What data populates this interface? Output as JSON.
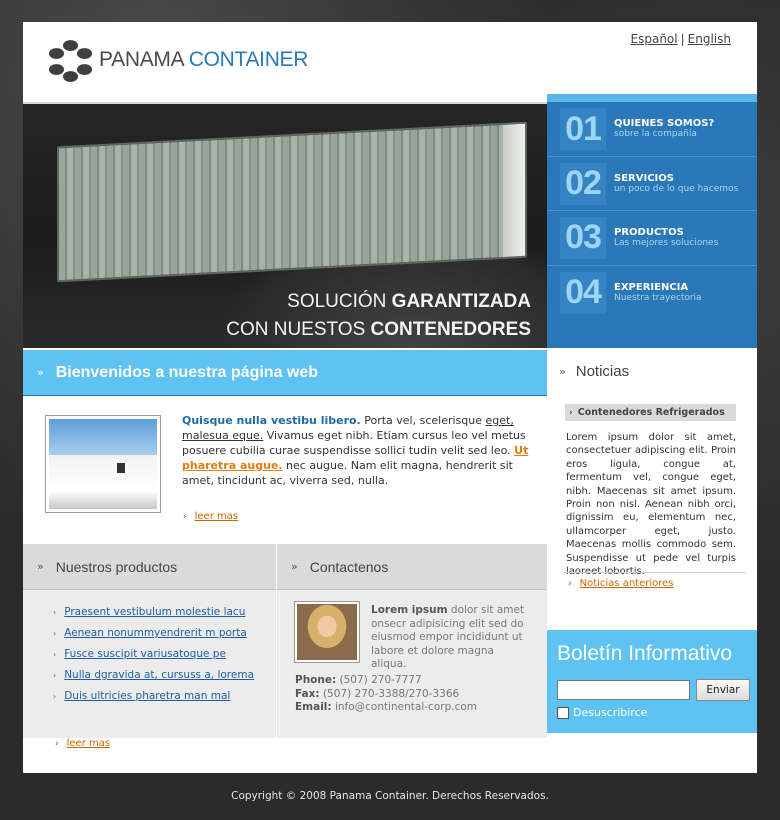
{
  "header": {
    "logo_text_part1": "PANAMA",
    "logo_text_part2": "CONTAINER",
    "lang_es": "Español",
    "lang_sep": "|",
    "lang_en": "English"
  },
  "hero": {
    "line1_normal": "SOLUCIÓN",
    "line1_bold": "GARANTIZADA",
    "line2_normal": "CON NUESTOS",
    "line2_bold": "CONTENEDORES"
  },
  "nav": {
    "items": [
      {
        "num": "01",
        "title": "QUIENES SOMOS?",
        "sub": "sobre la compañía"
      },
      {
        "num": "02",
        "title": "SERVICIOS",
        "sub": "un poco de lo que hacemos"
      },
      {
        "num": "03",
        "title": "PRODUCTOS",
        "sub": "Las mejores soluciones"
      },
      {
        "num": "04",
        "title": "EXPERIENCIA",
        "sub": "Nuestra trayectoria"
      }
    ]
  },
  "welcome": {
    "title": "Bienvenidos a nuestra página web",
    "lead": "Quisque nulla vestibu libero.",
    "text1": " Porta vel, scelerisque ",
    "link1": "eget, malesua eque.",
    "text2": " Vivamus eget nibh. Etiam cursus leo vel metus posuere cubilia curae suspendisse sollici tudin velit sed leo. ",
    "link2": "Ut pharetra augue.",
    "text3": " nec augue. Nam elit magna, hendrerit sit amet, tincidunt ac, viverra sed, nulla.",
    "more": "leer mas"
  },
  "products": {
    "title": "Nuestros productos",
    "items": [
      "Praesent vestibulum molestie lacu",
      "Aenean nonummyendrerit m porta",
      "Fusce suscipit variusatoque pe",
      "Nulla dgravida at, cursuss a, lorema",
      "Duis ultricies pharetra man mal"
    ],
    "more": "leer mas"
  },
  "contact": {
    "title": "Contactenos",
    "lead": "Lorem ipsum",
    "text": " dolor sit amet onsecr adipisicing elit sed do eiusmod empor incididunt ut labore et dolore magna aliqua.",
    "phone_label": "Phone:",
    "phone": " (507) 270-7777",
    "fax_label": "Fax:",
    "fax": " (507) 270-3388/270-3366",
    "email_label": "Email:",
    "email": " info@continental-corp.com"
  },
  "news": {
    "title": "Noticias",
    "item_title": "Contenedores Refrigerados",
    "item_text": "Lorem ipsum dolor sit amet, consectetuer adipiscing elit. Proin eros ligula, congue at, fermentum vel, congue eget, nibh. Maecenas sit amet ipsum. Proin non nisl. Aenean nibh orci, dignissim eu, elementum nec, ullamcorper eget, justo. Maecenas mollis commodo sem. Suspendisse ut pede vel turpis laoreet lobortis.",
    "more": "Noticias anteriores"
  },
  "newsletter": {
    "title": "Boletín Informativo",
    "input_value": "",
    "button": "Enviar",
    "unsubscribe": "Desuscribirce"
  },
  "footer": {
    "copyright": "Copyright © 2008 Panama Container. Derechos Reservados."
  },
  "colors": {
    "brand_blue": "#2a78b8",
    "light_blue": "#5ec2f2",
    "link_orange": "#cc6600"
  }
}
